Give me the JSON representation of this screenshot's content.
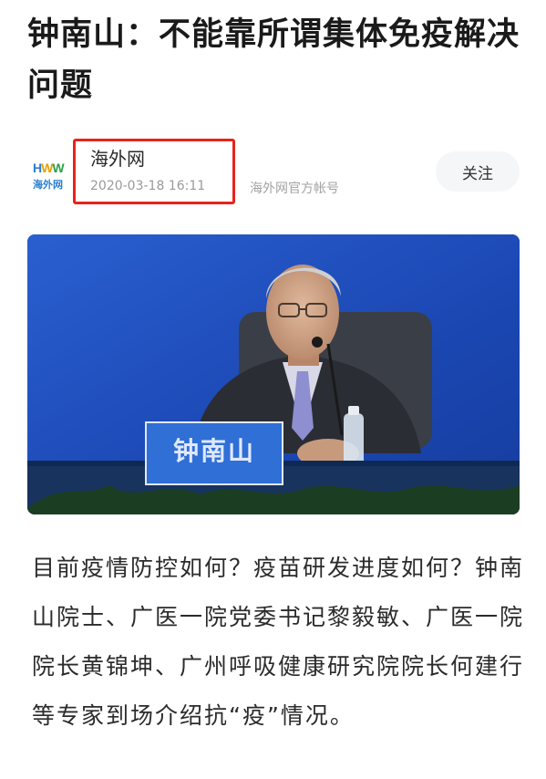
{
  "article": {
    "title": "钟南山：不能靠所谓集体免疫解决问题",
    "author": {
      "logo_mark": {
        "h": "H",
        "w1": "W",
        "w2": "W"
      },
      "logo_text": "海外网",
      "name": "海外网",
      "publish_time": "2020-03-18 16:11",
      "official_label": "海外网官方帐号"
    },
    "follow_label": "关注",
    "photo": {
      "nameplate": "钟南山"
    },
    "body_text": "目前疫情防控如何？疫苗研发进度如何？钟南山院士、广医一院党委书记黎毅敏、广医一院院长黄锦坤、广州呼吸健康研究院院长何建行等专家到场介绍抗“疫”情况。"
  },
  "colors": {
    "highlight_box": "#e8231c",
    "photo_background": "#1d49b8",
    "nameplate": "#2f6fd6"
  }
}
